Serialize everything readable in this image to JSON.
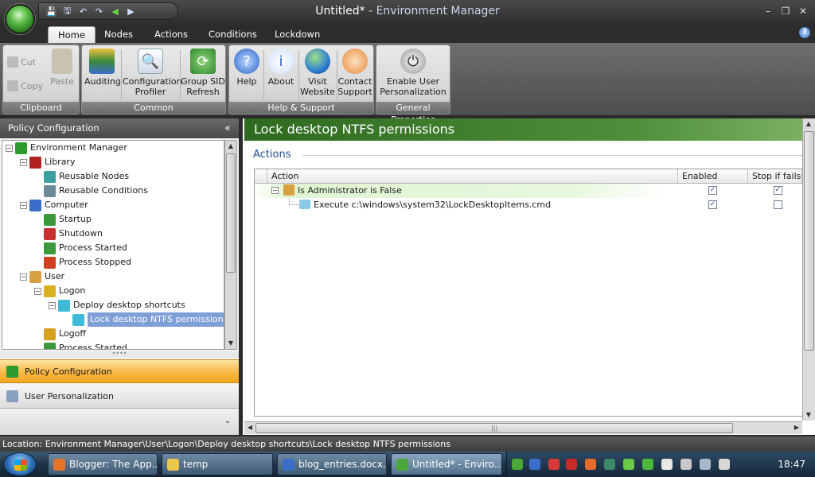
{
  "window": {
    "title_doc": "Untitled*",
    "title_sep": " - ",
    "title_app": "Environment Manager",
    "minimize": "–",
    "restore": "❐",
    "close": "✕"
  },
  "qat": {
    "save": "💾",
    "saveas": "🖫",
    "undo": "↶",
    "redo": "↷",
    "back": "◀",
    "forward": "▶"
  },
  "tabs": [
    "Home",
    "Nodes",
    "Actions",
    "Conditions",
    "Lockdown"
  ],
  "help_glyph": "?",
  "ribbon": {
    "clipboard": {
      "label": "Clipboard",
      "cut": "Cut",
      "copy": "Copy",
      "paste": "Paste"
    },
    "common": {
      "label": "Common",
      "auditing": "Auditing",
      "config_profiler": [
        "Configuration",
        "Profiler"
      ],
      "group_sid": [
        "Group SID",
        "Refresh"
      ]
    },
    "help_support": {
      "label": "Help & Support",
      "help": "Help",
      "about": "About",
      "visit": [
        "Visit",
        "Website"
      ],
      "contact": [
        "Contact",
        "Support"
      ]
    },
    "general": {
      "label": "General Properties",
      "enable": [
        "Enable User",
        "Personalization"
      ]
    }
  },
  "left_panel": {
    "header": "Policy Configuration",
    "collapse_glyph": "«",
    "tree": [
      {
        "label": "Environment Manager",
        "icon": "environment-manager-icon",
        "color": "#2e9a2e"
      },
      {
        "label": "Library",
        "icon": "library-icon",
        "color": "#b32020"
      },
      {
        "label": "Reusable Nodes",
        "icon": "reusable-nodes-icon",
        "color": "#3aa0a0"
      },
      {
        "label": "Reusable Conditions",
        "icon": "reusable-conditions-icon",
        "color": "#6a8a9a"
      },
      {
        "label": "Computer",
        "icon": "computer-icon",
        "color": "#3a6ec8"
      },
      {
        "label": "Startup",
        "icon": "startup-icon",
        "color": "#3a9a3a"
      },
      {
        "label": "Shutdown",
        "icon": "shutdown-icon",
        "color": "#c83030"
      },
      {
        "label": "Process Started",
        "icon": "process-started-icon",
        "color": "#3a9a3a"
      },
      {
        "label": "Process Stopped",
        "icon": "process-stopped-icon",
        "color": "#d04020"
      },
      {
        "label": "User",
        "icon": "user-icon",
        "color": "#d8a040"
      },
      {
        "label": "Logon",
        "icon": "logon-icon",
        "color": "#d8b020"
      },
      {
        "label": "Deploy desktop shortcuts",
        "icon": "deploy-shortcuts-icon",
        "color": "#40b8d8"
      },
      {
        "label": "Lock desktop NTFS permissions",
        "icon": "lock-permissions-icon",
        "color": "#40b8d8"
      },
      {
        "label": "Logoff",
        "icon": "logoff-icon",
        "color": "#d8a020"
      },
      {
        "label": "Process Started",
        "icon": "process-started-icon",
        "color": "#3a9a3a"
      }
    ],
    "nav": {
      "policy": "Policy Configuration",
      "personalization": "User Personalization",
      "more_glyph": "⌄"
    }
  },
  "right_panel": {
    "header": "Lock desktop NTFS permissions",
    "section_title": "Actions",
    "columns": {
      "action": "Action",
      "enabled": "Enabled",
      "stop": "Stop if fails"
    },
    "rows": [
      {
        "label": "Is Administrator is False",
        "enabled": "✓",
        "stop": "✓"
      },
      {
        "label": "Execute c:\\windows\\system32\\LockDesktopItems.cmd",
        "enabled": "✓",
        "stop": ""
      }
    ]
  },
  "status": {
    "location": "Location: Environment Manager\\User\\Logon\\Deploy desktop shortcuts\\Lock desktop NTFS permissions"
  },
  "taskbar": {
    "items": [
      {
        "label": "Blogger: The App...",
        "color": "#e8742a"
      },
      {
        "label": "temp",
        "color": "#e8c84a"
      },
      {
        "label": "blog_entries.docx...",
        "color": "#3a6ec8"
      },
      {
        "label": "Untitled* - Enviro...",
        "color": "#4aa83a"
      }
    ],
    "clock": "18:47"
  }
}
